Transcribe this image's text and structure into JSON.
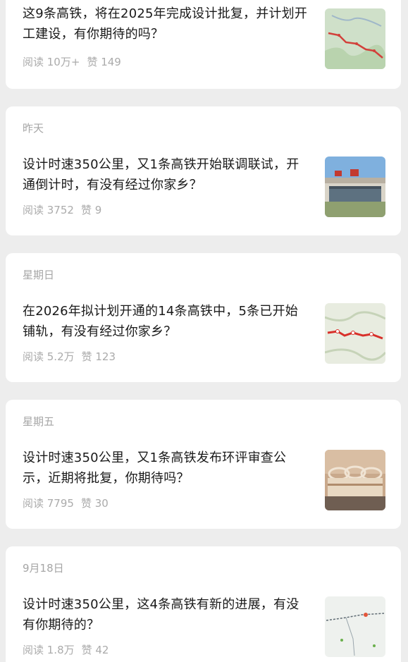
{
  "articles": [
    {
      "date": "",
      "title": "这9条高铁，将在2025年完成设计批复，并计划开工建设，有你期待的吗？",
      "read_label": "阅读 10万+",
      "like_label": "赞 149",
      "thumb_icon": "railway-map-thumbnail"
    },
    {
      "date": "昨天",
      "title": "设计时速350公里，又1条高铁开始联调联试，开通倒计时，有没有经过你家乡？",
      "read_label": "阅读 3752",
      "like_label": "赞 9",
      "thumb_icon": "railway-station-thumbnail"
    },
    {
      "date": "星期日",
      "title": "在2026年拟计划开通的14条高铁中，5条已开始铺轨，有没有经过你家乡？",
      "read_label": "阅读 5.2万",
      "like_label": "赞 123",
      "thumb_icon": "railway-map-thumbnail"
    },
    {
      "date": "星期五",
      "title": "设计时速350公里，又1条高铁发布环评审查公示，近期将批复，你期待吗？",
      "read_label": "阅读 7795",
      "like_label": "赞 30",
      "thumb_icon": "station-rendering-thumbnail"
    },
    {
      "date": "9月18日",
      "title": "设计时速350公里，这4条高铁有新的进展，有没有你期待的？",
      "read_label": "阅读 1.8万",
      "like_label": "赞 42",
      "thumb_icon": "route-map-thumbnail"
    }
  ]
}
